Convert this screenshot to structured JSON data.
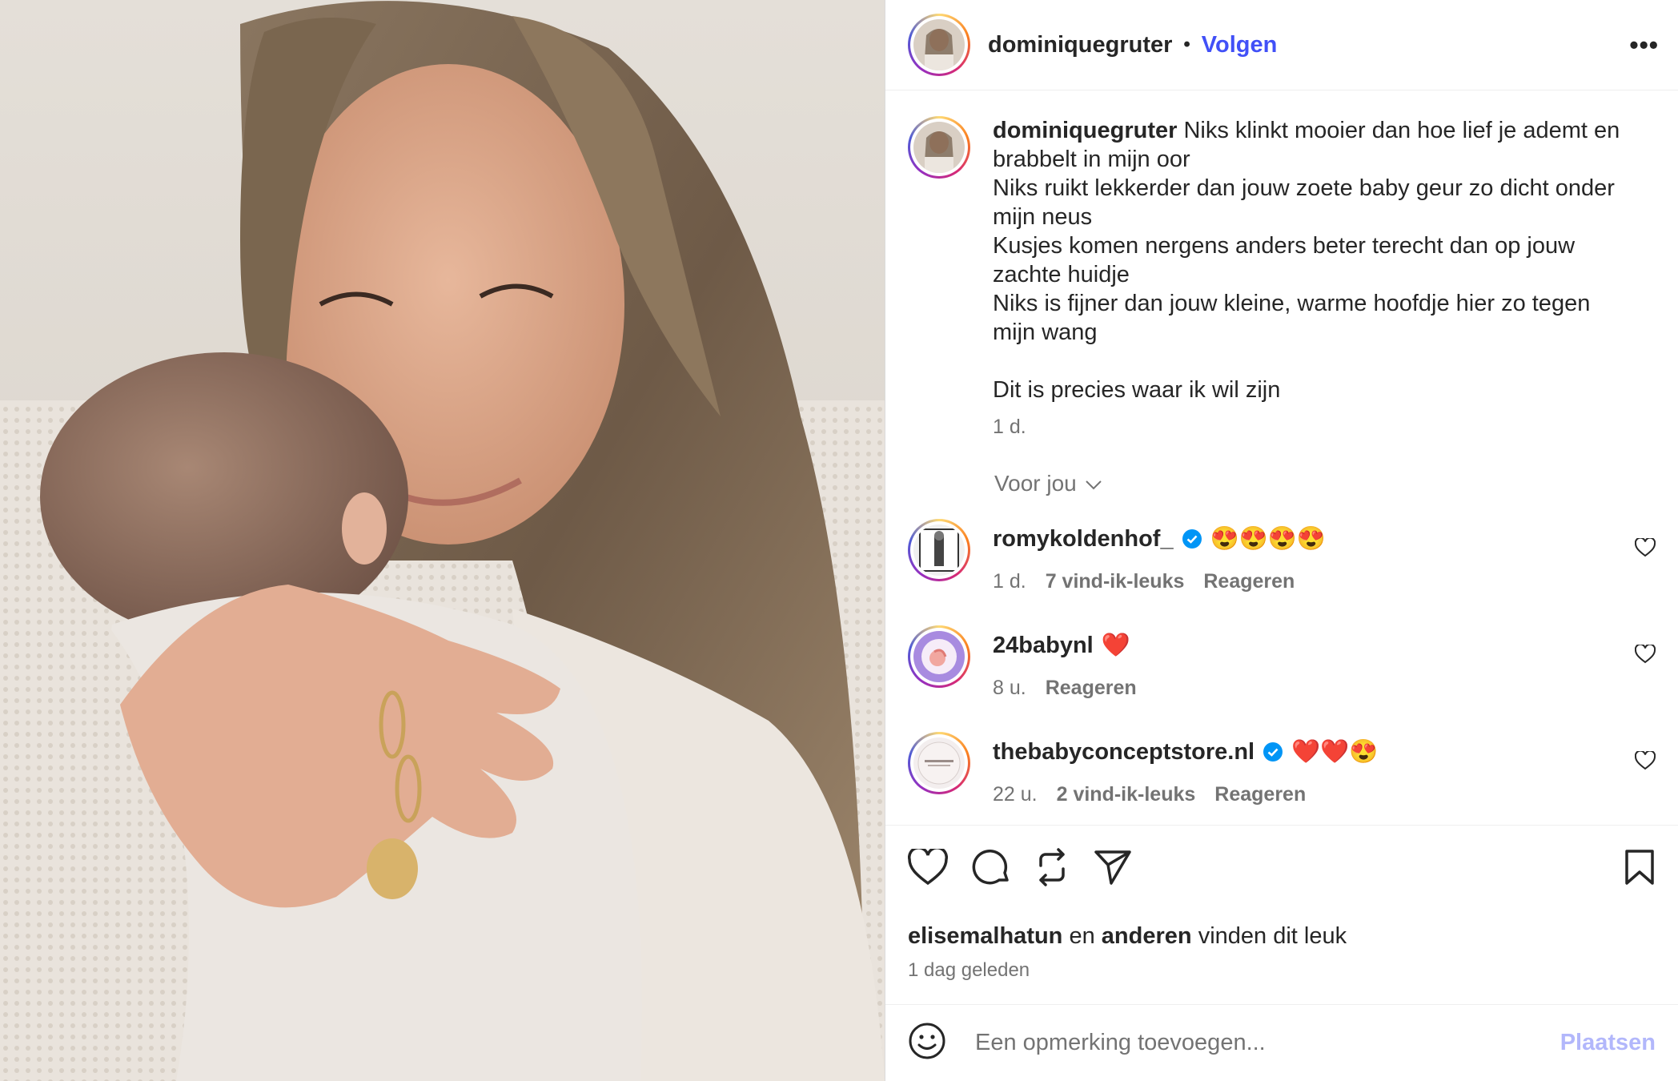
{
  "header": {
    "username": "dominiquegruter",
    "separator": "•",
    "follow_label": "Volgen",
    "more_label": "•••"
  },
  "caption": {
    "username": "dominiquegruter",
    "text": " Niks klinkt mooier dan hoe lief je ademt en\nbrabbelt in mijn oor\nNiks ruikt lekkerder dan jouw zoete baby geur zo dicht onder\nmijn neus\nKusjes komen nergens anders beter terecht dan op jouw\nzachte huidje\nNiks is fijner dan jouw kleine, warme hoofdje hier zo tegen\nmijn wang\n\nDit is precies waar ik wil zijn",
    "time": "1 d."
  },
  "for_you_label": "Voor jou",
  "comments": [
    {
      "username": "romykoldenhof_",
      "verified": true,
      "text": "😍😍😍😍",
      "time": "1 d.",
      "likes": "7 vind-ik-leuks",
      "reply": "Reageren"
    },
    {
      "username": "24babynl",
      "verified": false,
      "text": "❤️",
      "time": "8 u.",
      "likes": "",
      "reply": "Reageren"
    },
    {
      "username": "thebabyconceptstore.nl",
      "verified": true,
      "text": "❤️❤️😍",
      "time": "22 u.",
      "likes": "2 vind-ik-leuks",
      "reply": "Reageren"
    }
  ],
  "likes": {
    "user": "elisemalhatun",
    "connector": "en",
    "others": "anderen",
    "suffix": "vinden dit leuk"
  },
  "post_time": "1 dag geleden",
  "add_comment": {
    "placeholder": "Een opmerking toevoegen...",
    "post_label": "Plaatsen"
  },
  "icons": {
    "like": "heart-icon",
    "comment": "comment-icon",
    "repost": "repost-icon",
    "share": "send-icon",
    "save": "bookmark-icon",
    "emoji": "emoji-icon",
    "verified": "verified-badge-icon",
    "chevron": "chevron-down-icon"
  },
  "colors": {
    "follow": "#4150f7",
    "verified": "#0095f6",
    "muted": "#737373",
    "post_disabled": "#b2b7fb"
  }
}
